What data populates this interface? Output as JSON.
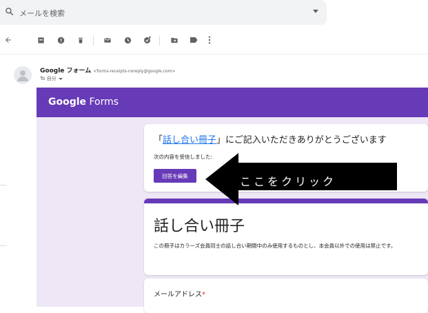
{
  "search": {
    "placeholder": "メールを検索"
  },
  "toolbar": {
    "icons": [
      "back-arrow-icon",
      "archive-icon",
      "report-spam-icon",
      "delete-icon",
      "mark-unread-icon",
      "snooze-icon",
      "add-task-icon",
      "move-to-icon",
      "labels-icon",
      "more-vert-icon"
    ]
  },
  "email": {
    "sender_name": "Google フォーム",
    "sender_email": "<forms-receipts-noreply@google.com>",
    "to_label": "To 自分"
  },
  "forms": {
    "logo_google": "Google",
    "logo_forms": "Forms",
    "thanks_open": "「",
    "thanks_link": "話し合い冊子",
    "thanks_rest": "」にご記入いただきありがとうございます",
    "received_text": "次の内容を受信しました:",
    "edit_button": "回答を編集",
    "form_title": "話し合い冊子",
    "form_description": "この冊子はカラーズ会員同士の話し合い期間中のみ使用するものとし、本会員以外での使用は禁止です。",
    "email_label": "メールアドレス",
    "required_mark": "*"
  },
  "callout": {
    "text": "ここをクリック"
  },
  "colors": {
    "purple": "#673ab7",
    "canvas": "#ede7f6",
    "link": "#1a73e8"
  }
}
